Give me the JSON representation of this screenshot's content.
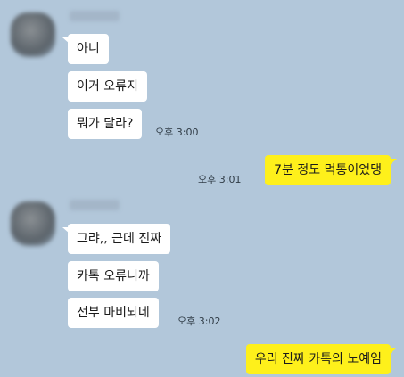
{
  "colors": {
    "background": "#b2c7da",
    "received_bubble": "#ffffff",
    "sent_bubble": "#fef01b"
  },
  "groups": [
    {
      "sender": "blurred-name",
      "messages": [
        "아니",
        "이거 오류지",
        "뭐가 달라?"
      ],
      "time": "오후 3:00"
    },
    {
      "sent_messages": [
        "7분 정도 먹통이었댕"
      ],
      "time": "오후 3:01"
    },
    {
      "sender": "blurred-name",
      "messages": [
        "그랴,, 근데 진짜",
        "카톡 오류니까",
        "전부 마비되네"
      ],
      "time": "오후 3:02"
    },
    {
      "sent_messages": [
        "우리 진짜 카톡의 노예임"
      ]
    }
  ]
}
